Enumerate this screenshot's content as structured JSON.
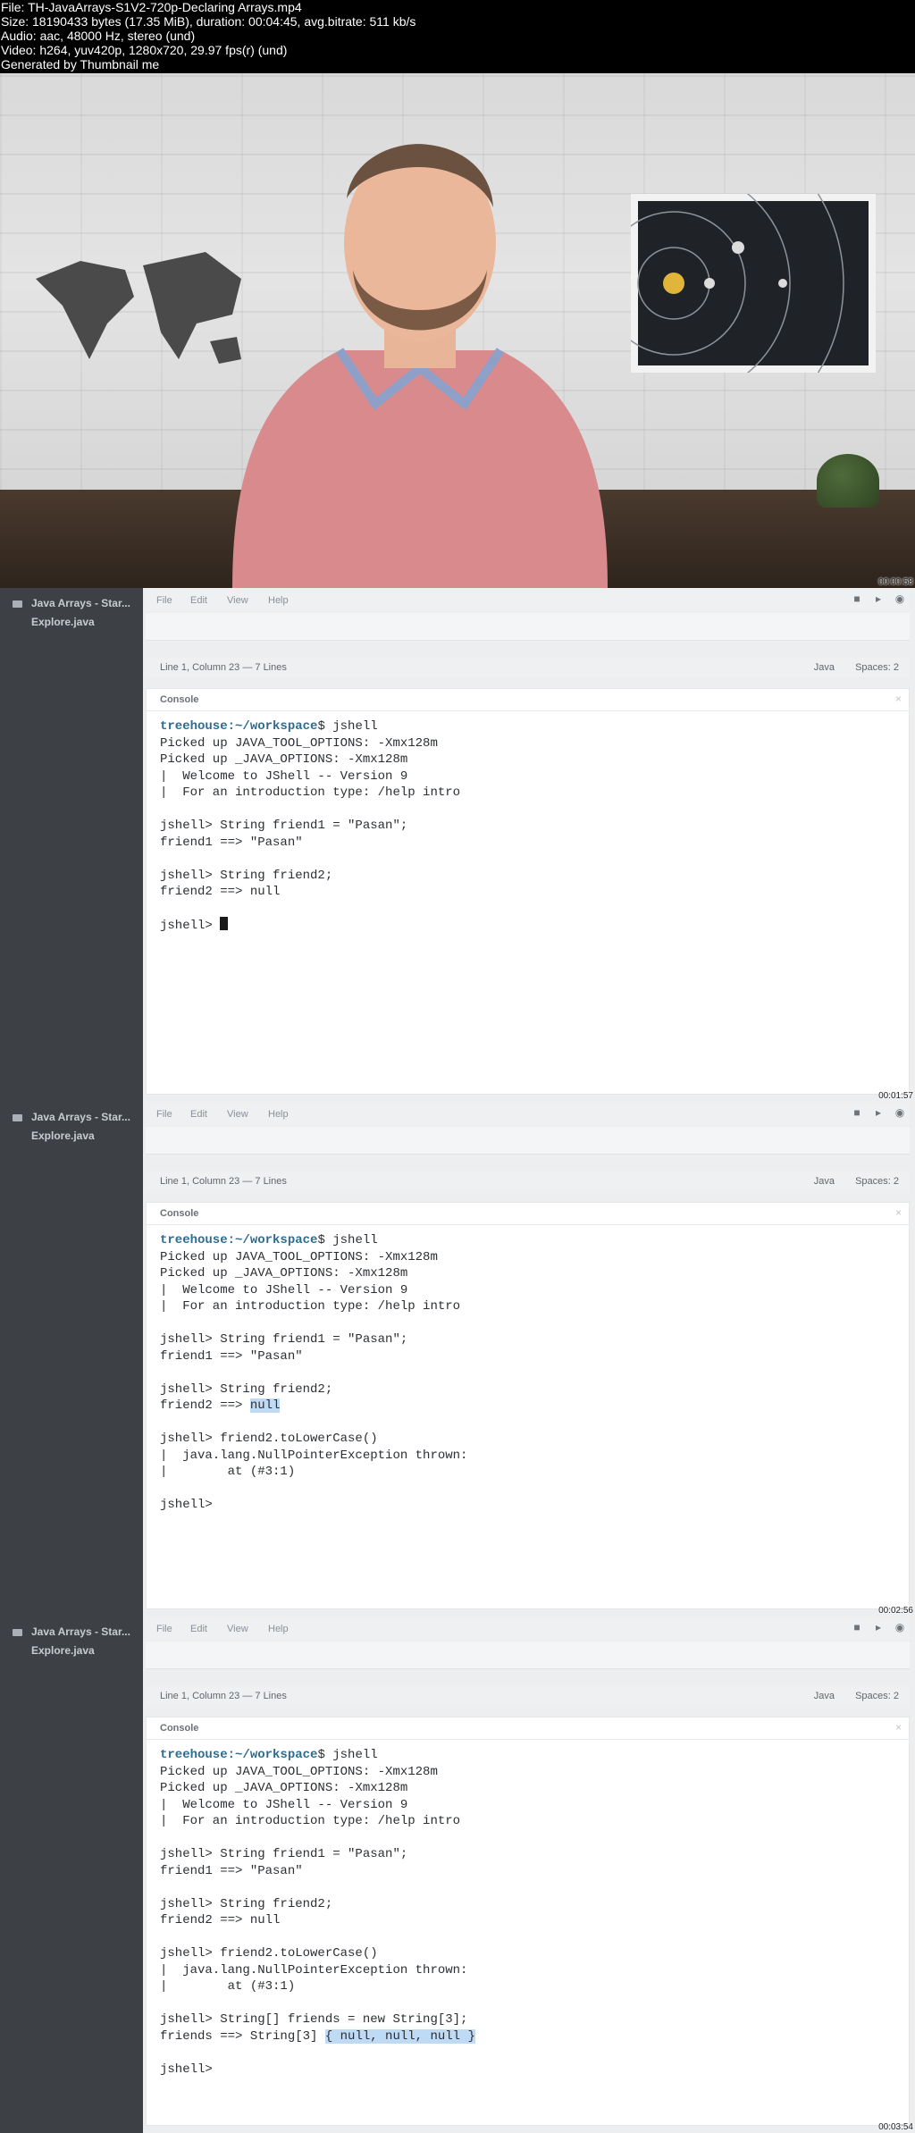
{
  "info": {
    "lines": [
      "File: TH-JavaArrays-S1V2-720p-Declaring Arrays.mp4",
      "Size: 18190433 bytes (17.35 MiB), duration: 00:04:45, avg.bitrate: 511 kb/s",
      "Audio: aac, 48000 Hz, stereo (und)",
      "Video: h264, yuv420p, 1280x720, 29.97 fps(r) (und)",
      "Generated by Thumbnail me"
    ]
  },
  "video_frame": {
    "timestamp": "00:00:58"
  },
  "editor": {
    "project": "Java Arrays - Star...",
    "file": "Explore.java",
    "menu": [
      "File",
      "Edit",
      "View",
      "Help"
    ],
    "status_left": "Line 1, Column 23 — 7 Lines",
    "status_lang": "Java",
    "status_spaces": "Spaces: 2",
    "console_title": "Console",
    "close_glyph": "×"
  },
  "frames": [
    {
      "timestamp": "00:01:57",
      "lines": [
        {
          "prompt": "treehouse:~/workspace",
          "text": "$ jshell"
        },
        {
          "text": "Picked up JAVA_TOOL_OPTIONS: -Xmx128m"
        },
        {
          "text": "Picked up _JAVA_OPTIONS: -Xmx128m"
        },
        {
          "text": "|  Welcome to JShell -- Version 9"
        },
        {
          "text": "|  For an introduction type: /help intro"
        },
        {
          "text": ""
        },
        {
          "text": "jshell> String friend1 = \"Pasan\";"
        },
        {
          "text": "friend1 ==> \"Pasan\""
        },
        {
          "text": ""
        },
        {
          "text": "jshell> String friend2;"
        },
        {
          "text": "friend2 ==> null"
        },
        {
          "text": ""
        },
        {
          "text": "jshell> ",
          "cursor": true
        }
      ]
    },
    {
      "timestamp": "00:02:56",
      "lines": [
        {
          "prompt": "treehouse:~/workspace",
          "text": "$ jshell"
        },
        {
          "text": "Picked up JAVA_TOOL_OPTIONS: -Xmx128m"
        },
        {
          "text": "Picked up _JAVA_OPTIONS: -Xmx128m"
        },
        {
          "text": "|  Welcome to JShell -- Version 9"
        },
        {
          "text": "|  For an introduction type: /help intro"
        },
        {
          "text": ""
        },
        {
          "text": "jshell> String friend1 = \"Pasan\";"
        },
        {
          "text": "friend1 ==> \"Pasan\""
        },
        {
          "text": ""
        },
        {
          "text": "jshell> String friend2;"
        },
        {
          "text": "friend2 ==> ",
          "hl": "null"
        },
        {
          "text": ""
        },
        {
          "text": "jshell> friend2.toLowerCase()"
        },
        {
          "text": "|  java.lang.NullPointerException thrown:"
        },
        {
          "text": "|        at (#3:1)"
        },
        {
          "text": ""
        },
        {
          "text": "jshell>"
        }
      ]
    },
    {
      "timestamp": "00:03:54",
      "lines": [
        {
          "prompt": "treehouse:~/workspace",
          "text": "$ jshell"
        },
        {
          "text": "Picked up JAVA_TOOL_OPTIONS: -Xmx128m"
        },
        {
          "text": "Picked up _JAVA_OPTIONS: -Xmx128m"
        },
        {
          "text": "|  Welcome to JShell -- Version 9"
        },
        {
          "text": "|  For an introduction type: /help intro"
        },
        {
          "text": ""
        },
        {
          "text": "jshell> String friend1 = \"Pasan\";"
        },
        {
          "text": "friend1 ==> \"Pasan\""
        },
        {
          "text": ""
        },
        {
          "text": "jshell> String friend2;"
        },
        {
          "text": "friend2 ==> null"
        },
        {
          "text": ""
        },
        {
          "text": "jshell> friend2.toLowerCase()"
        },
        {
          "text": "|  java.lang.NullPointerException thrown:"
        },
        {
          "text": "|        at (#3:1)"
        },
        {
          "text": ""
        },
        {
          "text": "jshell> String[] friends = new String[3];"
        },
        {
          "text": "friends ==> String[3] ",
          "hl": "{ null, null, null }"
        },
        {
          "text": ""
        },
        {
          "text": "jshell>"
        }
      ]
    }
  ],
  "colors": {
    "prompt": "#2f6c8f",
    "highlight": "#bfdaf5",
    "sidebar": "#3d4145"
  },
  "icons": [
    "folder-icon",
    "camera-icon",
    "share-icon",
    "preview-eye-icon",
    "close-icon"
  ]
}
